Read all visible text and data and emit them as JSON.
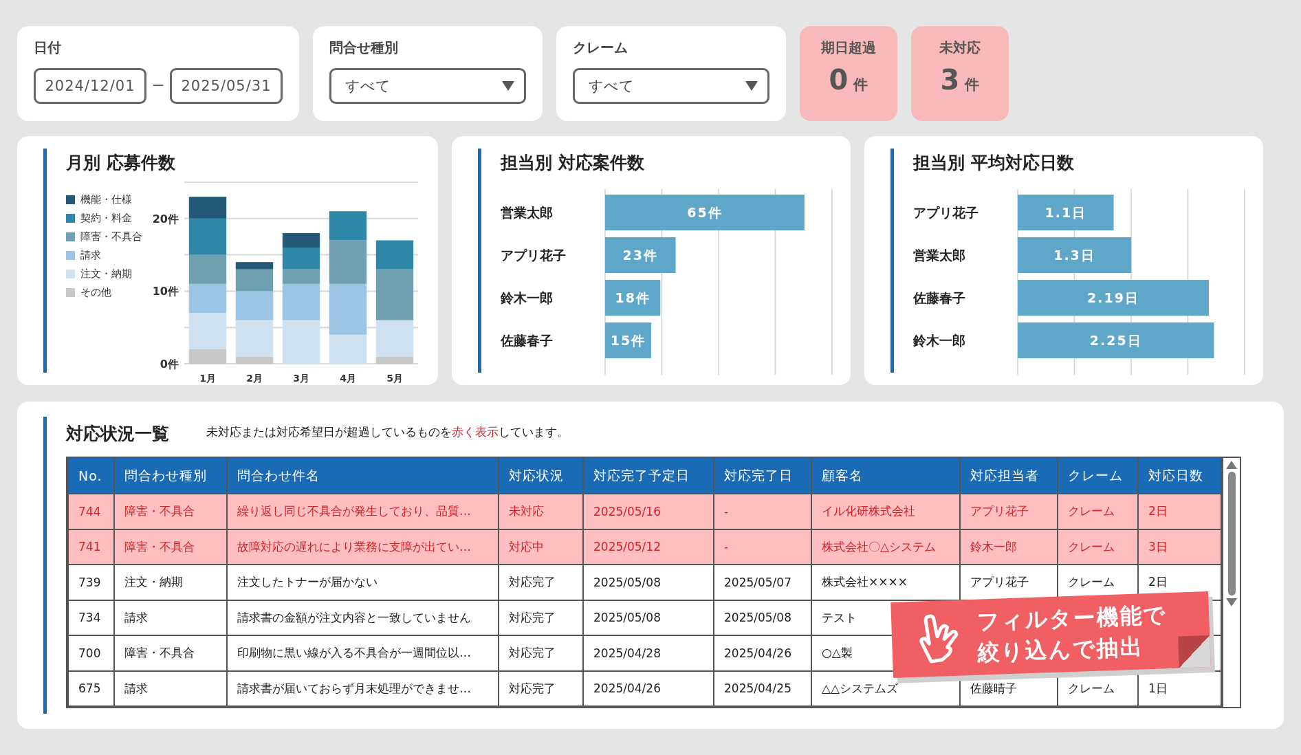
{
  "filters": {
    "date": {
      "label": "日付",
      "from": "2024/12/01",
      "separator": "ー",
      "to": "2025/05/31"
    },
    "dropdowns": [
      {
        "label": "問合せ種別",
        "value": "すべて"
      },
      {
        "label": "クレーム",
        "value": "すべて"
      }
    ]
  },
  "kpis": [
    {
      "label": "期日超過",
      "value": "0",
      "unit": "件"
    },
    {
      "label": "未対応",
      "value": "3",
      "unit": "件"
    }
  ],
  "monthly_chart": {
    "title": "月別 応募件数",
    "chart_data": {
      "type": "bar",
      "stacked": true,
      "categories": [
        "1月",
        "2月",
        "3月",
        "4月",
        "5月"
      ],
      "ylim": [
        0,
        25
      ],
      "yticks": [
        {
          "value": 0,
          "label": "0件"
        },
        {
          "value": 10,
          "label": "10件"
        },
        {
          "value": 20,
          "label": "20件"
        }
      ],
      "series": [
        {
          "name": "その他",
          "color": "#c8c8c8",
          "values": [
            2,
            1,
            0,
            0,
            1
          ]
        },
        {
          "name": "注文・納期",
          "color": "#cfe0ef",
          "values": [
            5,
            5,
            6,
            4,
            5
          ]
        },
        {
          "name": "請求",
          "color": "#9cc4e4",
          "values": [
            4,
            4,
            5,
            7,
            0
          ]
        },
        {
          "name": "障害・不具合",
          "color": "#6ea0b0",
          "values": [
            4,
            3,
            2,
            6,
            7
          ]
        },
        {
          "name": "契約・料金",
          "color": "#2e86a8",
          "values": [
            5,
            0,
            3,
            4,
            4
          ]
        },
        {
          "name": "機能・仕様",
          "color": "#245a78",
          "values": [
            3,
            1,
            2,
            0,
            0
          ]
        }
      ]
    }
  },
  "staff_charts": [
    {
      "title": "担当別 対応案件数",
      "chart_data": {
        "type": "bar",
        "orientation": "horizontal",
        "categories": [
          "営業太郎",
          "アプリ花子",
          "鈴木一郎",
          "佐藤春子"
        ],
        "values": [
          65,
          23,
          18,
          15
        ],
        "xlim": [
          0,
          74
        ],
        "value_labels": [
          "65件",
          "23件",
          "18件",
          "15件"
        ]
      }
    },
    {
      "title": "担当別 平均対応日数",
      "chart_data": {
        "type": "bar",
        "orientation": "horizontal",
        "categories": [
          "アプリ花子",
          "営業太郎",
          "佐藤春子",
          "鈴木一郎"
        ],
        "values": [
          1.1,
          1.3,
          2.19,
          2.25
        ],
        "xlim": [
          0,
          2.6
        ],
        "value_labels": [
          "1.1日",
          "1.3日",
          "2.19日",
          "2.25日"
        ]
      }
    }
  ],
  "table": {
    "title": "対応状況一覧",
    "note": [
      {
        "text": "未対応または対応希望日が超過しているものを",
        "emphasis": false
      },
      {
        "text": "赤く表示",
        "emphasis": true
      },
      {
        "text": "しています。",
        "emphasis": false
      }
    ],
    "columns": [
      "No.",
      "問合わせ種別",
      "問合わせ件名",
      "対応状況",
      "対応完了予定日",
      "対応完了日",
      "顧客名",
      "対応担当者",
      "クレーム",
      "対応日数"
    ],
    "rows": [
      {
        "alert": true,
        "cells": [
          "744",
          "障害・不具合",
          "繰り返し同じ不具合が発生しており、品質…",
          "未対応",
          "2025/05/16",
          "-",
          "イル化研株式会社",
          "アプリ花子",
          "クレーム",
          "2日"
        ]
      },
      {
        "alert": true,
        "cells": [
          "741",
          "障害・不具合",
          "故障対応の遅れにより業務に支障が出てい…",
          "対応中",
          "2025/05/12",
          "-",
          "株式会社〇△システム",
          "鈴木一郎",
          "クレーム",
          "3日"
        ]
      },
      {
        "alert": false,
        "cells": [
          "739",
          "注文・納期",
          "注文したトナーが届かない",
          "対応完了",
          "2025/05/08",
          "2025/05/07",
          "株式会社××××",
          "アプリ花子",
          "クレーム",
          "2日"
        ]
      },
      {
        "alert": false,
        "cells": [
          "734",
          "請求",
          "請求書の金額が注文内容と一致していません",
          "対応完了",
          "2025/05/08",
          "2025/05/08",
          "テスト",
          "",
          "",
          ""
        ]
      },
      {
        "alert": false,
        "cells": [
          "700",
          "障害・不具合",
          "印刷物に黒い線が入る不具合が一週間位以…",
          "対応完了",
          "2025/04/28",
          "2025/04/26",
          "○△製",
          "",
          "",
          ""
        ]
      },
      {
        "alert": false,
        "cells": [
          "675",
          "請求",
          "請求書が届いておらず月末処理ができませ…",
          "対応完了",
          "2025/04/26",
          "2025/04/25",
          "△△システムズ",
          "佐藤晴子",
          "クレーム",
          "1日"
        ]
      }
    ]
  },
  "callout": {
    "lines": [
      "フィルター機能で",
      "絞り込んで抽出"
    ]
  }
}
